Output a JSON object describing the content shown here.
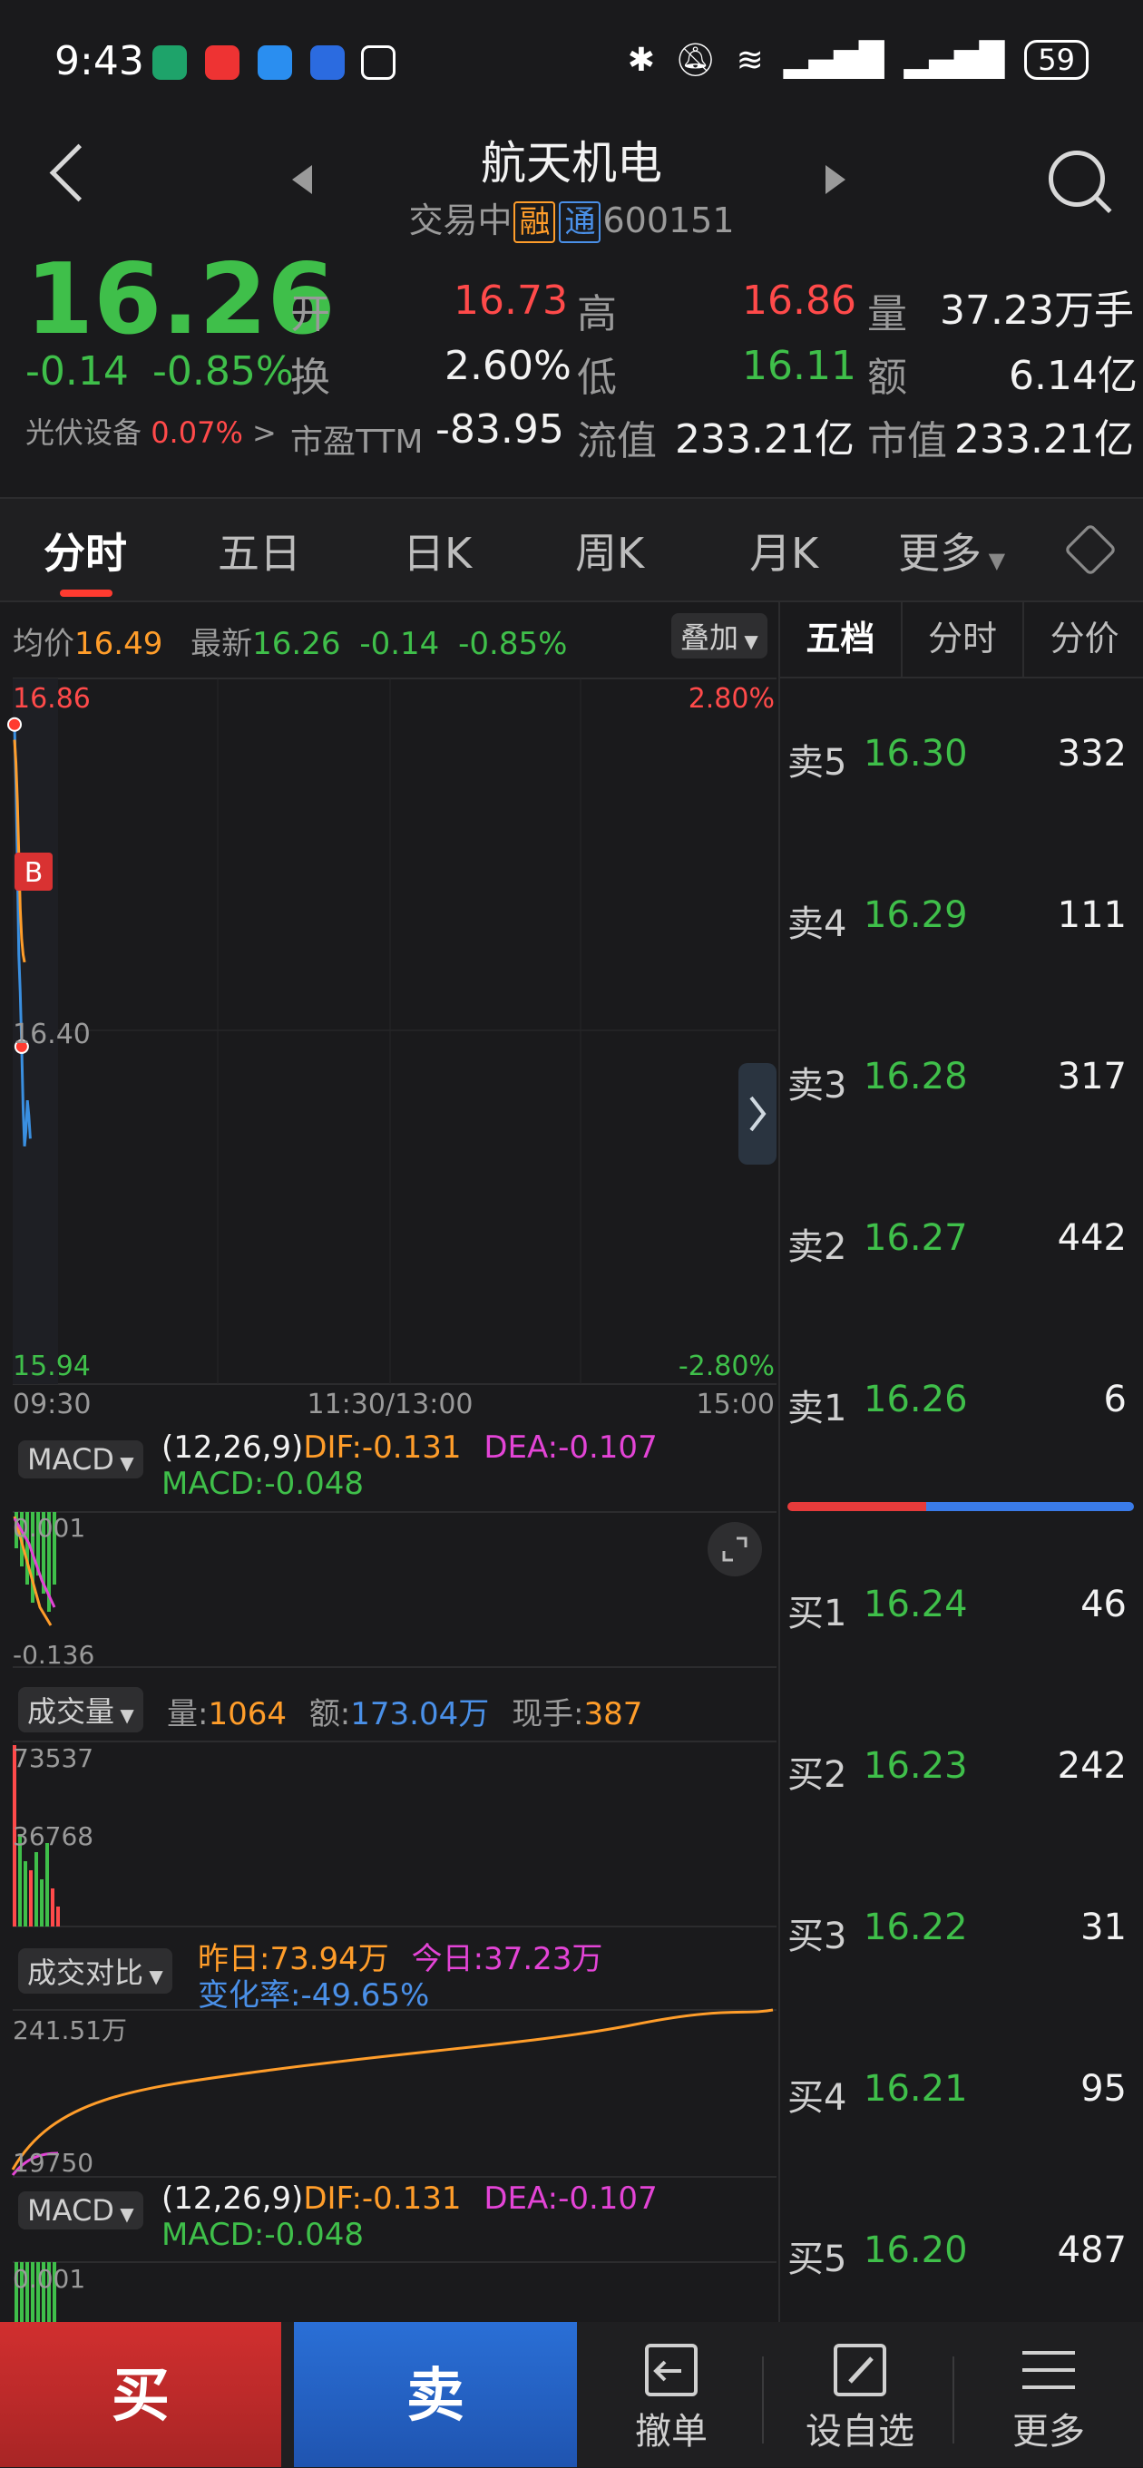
{
  "status": {
    "time": "9:43",
    "battery": "59"
  },
  "header": {
    "name": "航天机电",
    "status_text": "交易中",
    "tag_rong": "融",
    "tag_tong": "通",
    "code": "600151"
  },
  "quote": {
    "price": "16.26",
    "change": "-0.14",
    "change_pct": "-0.85%",
    "sector_name": "光伏设备",
    "sector_pct": "0.07%",
    "open_label": "开",
    "open": "16.73",
    "high_label": "高",
    "high": "16.86",
    "volume_label": "量",
    "volume": "37.23万手",
    "turnover_label": "换",
    "turnover": "2.60%",
    "low_label": "低",
    "low": "16.11",
    "amount_label": "额",
    "amount": "6.14亿",
    "pe_label": "市盈TTM",
    "pe": "-83.95",
    "float_cap_label": "流值",
    "float_cap": "233.21亿",
    "mkt_cap_label": "市值",
    "mkt_cap": "233.21亿"
  },
  "tabs": [
    "分时",
    "五日",
    "日K",
    "周K",
    "月K",
    "更多"
  ],
  "chart_info": {
    "avg_label": "均价",
    "avg": "16.49",
    "latest_label": "最新",
    "latest": "16.26",
    "chg": "-0.14",
    "chg_pct": "-0.85%",
    "overlay_btn": "叠加"
  },
  "chart_data": [
    {
      "type": "line",
      "title": "",
      "y_left_ticks": [
        "16.86",
        "16.40",
        "15.94"
      ],
      "y_right_ticks": [
        "2.80%",
        "-2.80%"
      ],
      "x_ticks": [
        "09:30",
        "11:30/13:00",
        "15:00"
      ],
      "ylim": [
        15.94,
        16.86
      ],
      "series": [
        {
          "name": "最新",
          "color": "#3a8fe0",
          "values": [
            16.8,
            16.72,
            16.62,
            16.5,
            16.45,
            16.38,
            16.3,
            16.25,
            16.27,
            16.31,
            16.29,
            16.26
          ]
        },
        {
          "name": "均价",
          "color": "#ff9d2a",
          "values": [
            16.78,
            16.75,
            16.7,
            16.63,
            16.56,
            16.52,
            16.5,
            16.49
          ]
        }
      ],
      "markers": [
        {
          "label": "B"
        }
      ]
    }
  ],
  "macd1": {
    "menu": "MACD",
    "params": "(12,26,9)",
    "dif": "DIF:-0.131",
    "dea": "DEA:-0.107",
    "macd": "MACD:-0.048",
    "tick_top": "0.001",
    "tick_bottom": "-0.136"
  },
  "volume_panel": {
    "menu": "成交量",
    "vol_label": "量:",
    "vol": "1064",
    "amt_label": "额:",
    "amt": "173.04万",
    "hand_label": "现手:",
    "hand": "387",
    "tick_top": "73537",
    "tick_mid": "36768"
  },
  "compare_panel": {
    "menu": "成交对比",
    "yesterday": "昨日:73.94万",
    "today": "今日:37.23万",
    "rate": "变化率:-49.65%",
    "tick_top": "241.51万",
    "tick_bottom": "19750"
  },
  "macd2": {
    "menu": "MACD",
    "params": "(12,26,9)",
    "dif": "DIF:-0.131",
    "dea": "DEA:-0.107",
    "macd": "MACD:-0.048",
    "tick_top": "0.001"
  },
  "book": {
    "tabs": [
      "五档",
      "分时",
      "分价"
    ],
    "sells": [
      {
        "label": "卖5",
        "price": "16.30",
        "vol": "332"
      },
      {
        "label": "卖4",
        "price": "16.29",
        "vol": "111"
      },
      {
        "label": "卖3",
        "price": "16.28",
        "vol": "317"
      },
      {
        "label": "卖2",
        "price": "16.27",
        "vol": "442"
      },
      {
        "label": "卖1",
        "price": "16.26",
        "vol": "6"
      }
    ],
    "buys": [
      {
        "label": "买1",
        "price": "16.24",
        "vol": "46"
      },
      {
        "label": "买2",
        "price": "16.23",
        "vol": "242"
      },
      {
        "label": "买3",
        "price": "16.22",
        "vol": "31"
      },
      {
        "label": "买4",
        "price": "16.21",
        "vol": "95"
      },
      {
        "label": "买5",
        "price": "16.20",
        "vol": "487"
      }
    ],
    "buy_ratio": 0.4
  },
  "bottom": {
    "buy": "买",
    "sell": "卖",
    "cancel": "撤单",
    "watch": "设自选",
    "more": "更多"
  },
  "colors": {
    "up": "#ff4a4a",
    "down": "#3fbf4a",
    "avg": "#ff9d2a",
    "price_line": "#3a8fe0"
  }
}
